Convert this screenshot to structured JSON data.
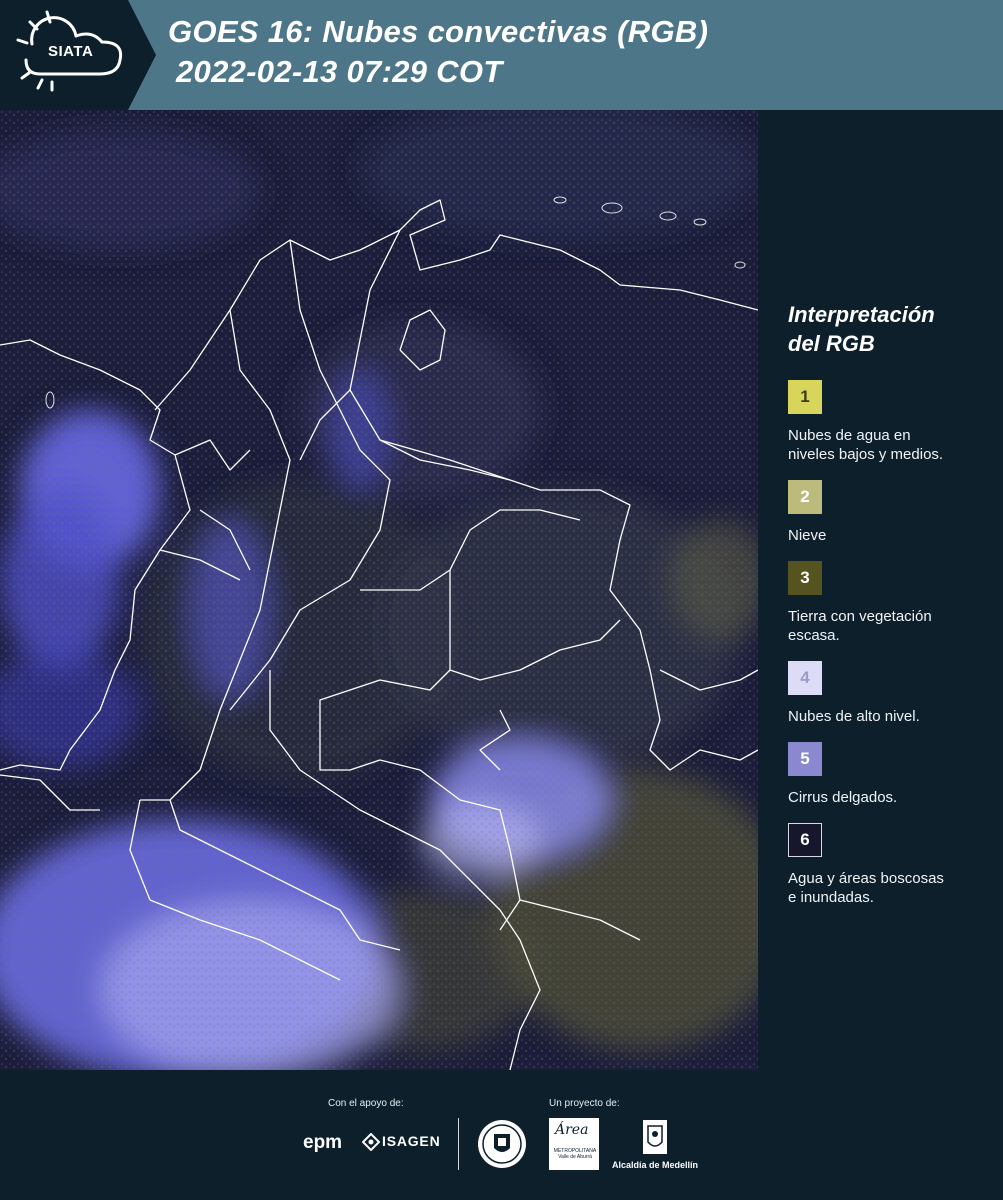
{
  "header": {
    "logo_text": "SIATA",
    "title_line1": "GOES 16: Nubes convectivas (RGB)",
    "title_line2": "2022-02-13 07:29 COT",
    "background_color": "#4d7688",
    "logo_block_color": "#0c1f2b"
  },
  "map": {
    "description_icon": "satellite-rgb-image",
    "region": "Colombia",
    "border_color": "#ffffff"
  },
  "legend": {
    "title_line1": "Interpretación",
    "title_line2": "del RGB",
    "items": [
      {
        "number": "1",
        "label_line1": "Nubes de agua en",
        "label_line2": "niveles bajos y medios.",
        "color": "#d8d65a",
        "text_color": "#3b3a10"
      },
      {
        "number": "2",
        "label_line1": "Nieve",
        "label_line2": "",
        "color": "#bcbb7c",
        "text_color": "#ffffff"
      },
      {
        "number": "3",
        "label_line1": "Tierra con vegetación",
        "label_line2": "escasa.",
        "color": "#55531f",
        "text_color": "#ffffff"
      },
      {
        "number": "4",
        "label_line1": "Nubes de alto nivel.",
        "label_line2": "",
        "color": "#dcdcf7",
        "text_color": "#9c9cc6"
      },
      {
        "number": "5",
        "label_line1": "Cirrus delgados.",
        "label_line2": "",
        "color": "#8a89cf",
        "text_color": "#ffffff"
      },
      {
        "number": "6",
        "label_line1": "Agua y áreas boscosas",
        "label_line2": "e inundadas.",
        "color": "#16162c",
        "text_color": "#ffffff"
      }
    ]
  },
  "footer": {
    "support_caption": "Con el apoyo de:",
    "project_caption": "Un proyecto de:",
    "epm_text": "epm",
    "isagen_text": "ISAGEN",
    "area_script": "Área",
    "area_small": "METROPOLITANA Valle de Aburrá",
    "alcaldia_text": "Alcaldía de Medellín"
  }
}
